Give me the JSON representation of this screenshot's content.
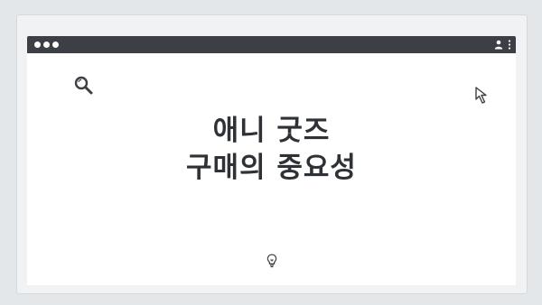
{
  "slide": {
    "title_line1": "애니 굿즈",
    "title_line2": "구매의 중요성"
  },
  "icons": {
    "search": "search-icon",
    "cursor": "cursor-arrow-icon",
    "lightbulb": "lightbulb-icon",
    "user": "user-icon",
    "menu": "kebab-menu-icon"
  },
  "colors": {
    "background": "#e3e7ea",
    "titlebar": "#3c4044",
    "content": "#ffffff",
    "title_text": "#2e3236"
  }
}
